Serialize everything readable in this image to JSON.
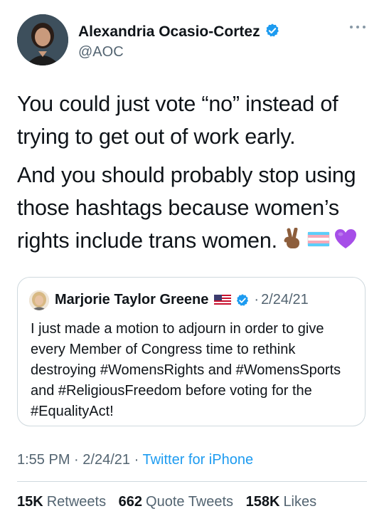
{
  "author": {
    "name": "Alexandria Ocasio-Cortez",
    "handle": "@AOC"
  },
  "tweet": {
    "paragraph1": "You could just vote “no” instead of trying to get out of work early.",
    "paragraph2": "And you should probably stop using those hashtags because women’s rights include trans women.",
    "emojis": [
      "victory-hand-emoji",
      "transgender-flag-emoji",
      "purple-heart-emoji"
    ]
  },
  "quoted": {
    "name": "Marjorie Taylor Greene",
    "date_sep": "·",
    "date": "2/24/21",
    "text": "I just made a motion to adjourn in order to give every Member of Congress time to rethink destroying #WomensRights and #WomensSports and #ReligiousFreedom before voting for the #EqualityAct!"
  },
  "meta": {
    "time": "1:55 PM",
    "sep1": "·",
    "date": "2/24/21",
    "sep2": "·",
    "source": "Twitter for iPhone"
  },
  "stats": {
    "retweets_count": "15K",
    "retweets_label": "Retweets",
    "quotes_count": "662",
    "quotes_label": "Quote Tweets",
    "likes_count": "158K",
    "likes_label": "Likes"
  },
  "colors": {
    "link": "#1d9bf0",
    "secondary_text": "#536471",
    "verified": "#1d9bf0"
  }
}
